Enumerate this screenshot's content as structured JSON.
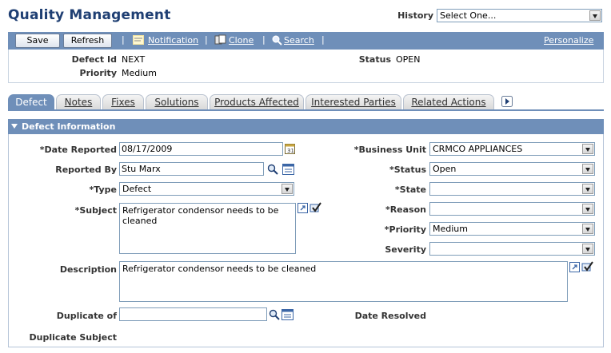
{
  "page": {
    "title": "Quality Management"
  },
  "history": {
    "label": "History",
    "value": "Select One..."
  },
  "toolbar": {
    "save": "Save",
    "refresh": "Refresh",
    "notification": "Notification",
    "clone": "Clone",
    "search": "Search",
    "personalize": "Personalize"
  },
  "header": {
    "defect_id_label": "Defect Id",
    "defect_id": "NEXT",
    "priority_label": "Priority",
    "priority": "Medium",
    "status_label": "Status",
    "status": "OPEN"
  },
  "tabs": [
    "Defect",
    "Notes",
    "Fixes",
    "Solutions",
    "Products Affected",
    "Interested Parties",
    "Related Actions"
  ],
  "section": {
    "title": "Defect Information"
  },
  "form": {
    "date_reported_label": "*Date Reported",
    "date_reported": "08/17/2009",
    "reported_by_label": "Reported By",
    "reported_by": "Stu Marx",
    "type_label": "*Type",
    "type": "Defect",
    "subject_label": "*Subject",
    "subject": "Refrigerator condensor needs to be cleaned",
    "description_label": "Description",
    "description": "Refrigerator condensor needs to be cleaned",
    "duplicate_of_label": "Duplicate of",
    "duplicate_of": "",
    "duplicate_subject_label": "Duplicate Subject",
    "business_unit_label": "*Business Unit",
    "business_unit": "CRMCO APPLIANCES",
    "status_label": "*Status",
    "status": "Open",
    "state_label": "*State",
    "state": "",
    "reason_label": "*Reason",
    "reason": "",
    "priority_label": "*Priority",
    "priority": "Medium",
    "severity_label": "Severity",
    "severity": "",
    "date_resolved_label": "Date Resolved"
  }
}
